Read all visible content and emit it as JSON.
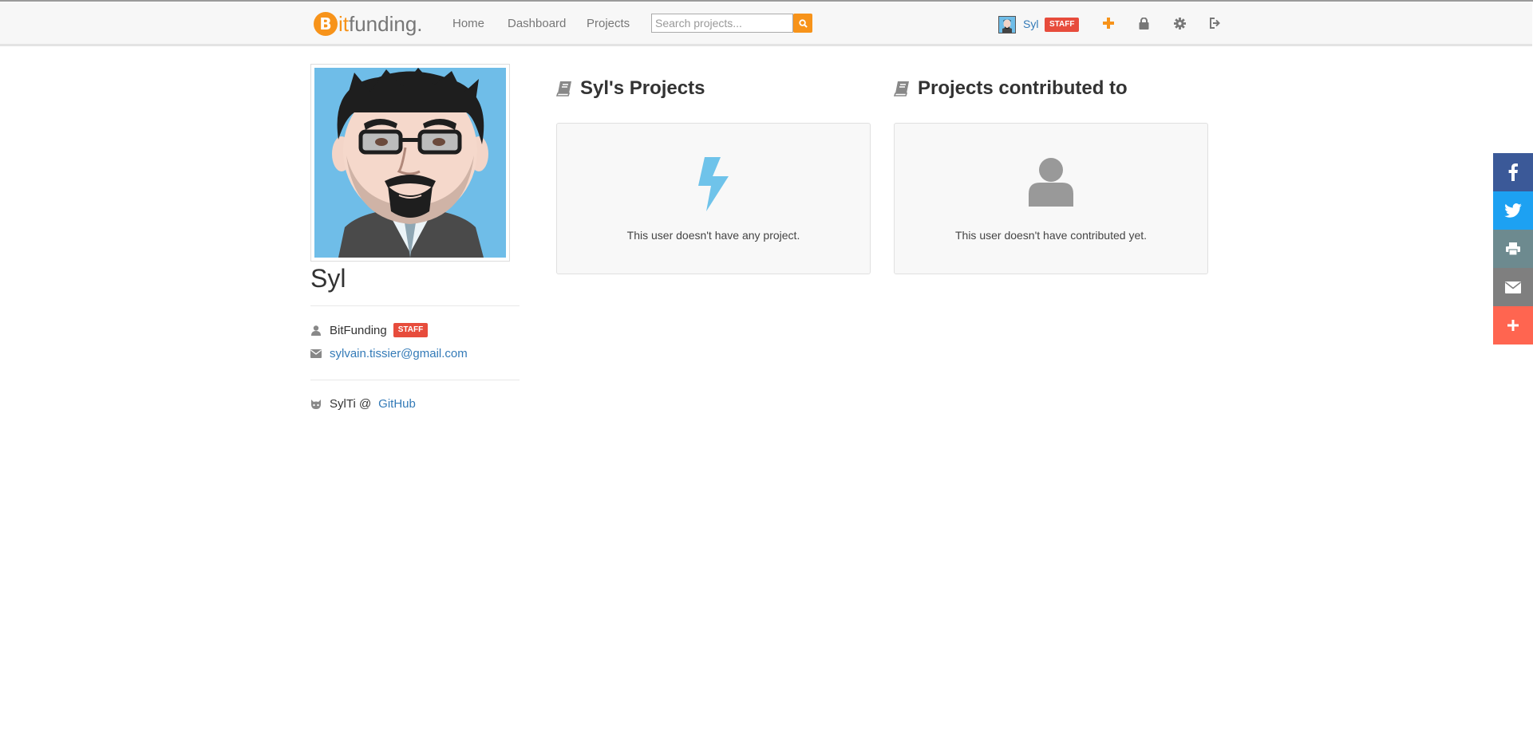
{
  "brand": {
    "coin": "B",
    "part1": "it",
    "part2": "funding."
  },
  "nav": {
    "home": "Home",
    "dashboard": "Dashboard",
    "projects": "Projects",
    "search_placeholder": "Search projects...",
    "user": "Syl",
    "user_badge": "STAFF"
  },
  "profile": {
    "name": "Syl",
    "company": "BitFunding",
    "company_badge": "STAFF",
    "email": "sylvain.tissier@gmail.com",
    "github_user": "SylTi @",
    "github_link": "GitHub"
  },
  "sections": {
    "own_title": "Syl's Projects",
    "own_message": "This user doesn't have any project.",
    "contrib_title": "Projects contributed to",
    "contrib_message": "This user doesn't have contributed yet."
  },
  "share": [
    "facebook-icon",
    "twitter-icon",
    "print-icon",
    "envelope-icon",
    "plus-icon"
  ],
  "colors": {
    "accent": "#f7931a",
    "link": "#337ab7",
    "badge": "#e74c3c",
    "facebook": "#3b5998",
    "twitter": "#1da1f2",
    "print": "#6d8a8f",
    "email": "#7f7f7f",
    "more": "#ff6550",
    "lightning": "#6fc3ea"
  }
}
